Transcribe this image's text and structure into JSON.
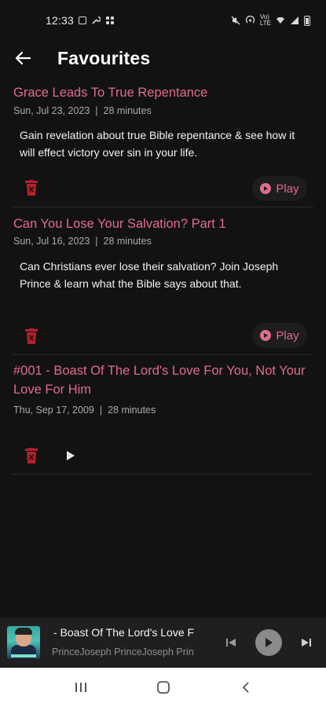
{
  "status_bar": {
    "time": "12:33",
    "left_icons": [
      "gallery-icon",
      "wrench-icon",
      "grid-icon"
    ],
    "right_icons": [
      "mute-icon",
      "hotspot-icon",
      "volte-icon",
      "wifi-icon",
      "signal-icon",
      "battery-icon"
    ]
  },
  "header": {
    "back_icon": "arrow-left-icon",
    "title": "Favourites"
  },
  "episodes": [
    {
      "title": "Grace Leads To True Repentance",
      "date": "Sun, Jul 23, 2023",
      "separator": "|",
      "duration": "28 minutes",
      "description": "Gain revelation about true Bible repentance & see how it will effect victory over sin in your life.",
      "play_label": "Play"
    },
    {
      "title": "Can You Lose Your Salvation? Part 1",
      "date": "Sun, Jul 16, 2023",
      "separator": "|",
      "duration": "28 minutes",
      "description": "Can Christians ever lose their salvation? Join Joseph Prince & learn what the Bible says about that.",
      "play_label": "Play"
    },
    {
      "title": "#001 - Boast Of The Lord's Love For You, Not Your Love For Him",
      "date": "Thu, Sep 17, 2009",
      "separator": "|",
      "duration": "28 minutes"
    }
  ],
  "mini_player": {
    "title": "- Boast Of The Lord's Love F",
    "artist": "PrinceJoseph PrinceJoseph Prin"
  },
  "colors": {
    "background": "#121212",
    "accent": "#e06c8c",
    "trash": "#b3202c"
  }
}
